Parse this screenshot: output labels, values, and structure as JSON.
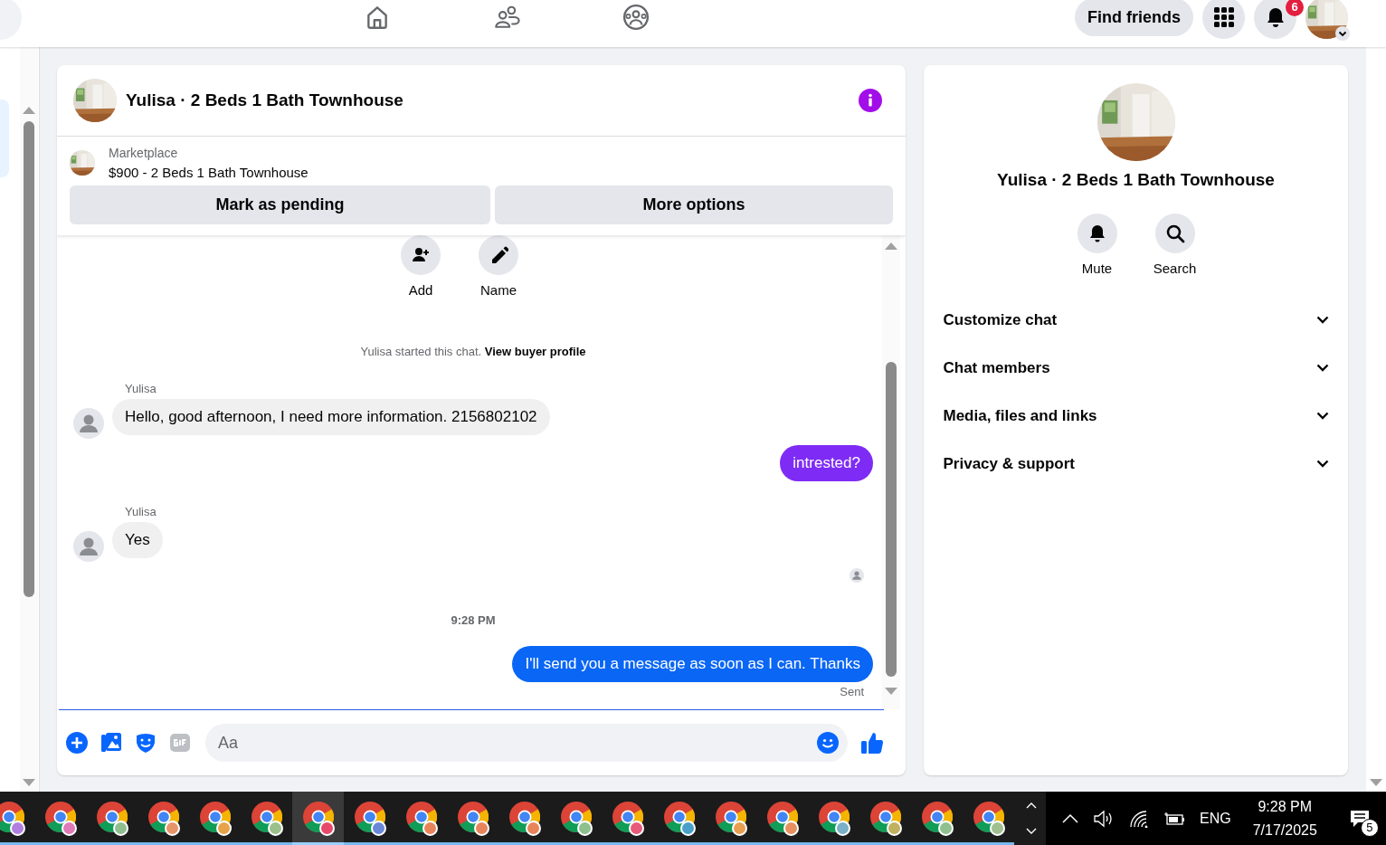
{
  "top_bar": {
    "nav": [
      {
        "kind": "home"
      },
      {
        "kind": "people"
      },
      {
        "kind": "groups"
      }
    ],
    "find_friends": "Find friends",
    "notification_badge": "6"
  },
  "chat": {
    "title": "Yulisa · 2 Beds 1 Bath Townhouse",
    "listing": {
      "label": "Marketplace",
      "title": "$900 - 2 Beds 1 Bath Townhouse"
    },
    "buttons": [
      "Mark as pending",
      "More options"
    ],
    "actions": [
      {
        "kind": "add",
        "label": "Add"
      },
      {
        "kind": "name",
        "label": "Name"
      }
    ],
    "messages": [
      {
        "kind": "system",
        "text": "Yulisa started this chat.",
        "link": "View buyer profile"
      },
      {
        "kind": "incoming",
        "sender": "Yulisa",
        "text": "Hello, good afternoon, I need more information. 2156802102"
      },
      {
        "kind": "outgoing",
        "text": "intrested?",
        "color": "#7e2cf5"
      },
      {
        "kind": "incoming",
        "sender": "Yulisa",
        "text": "Yes"
      },
      {
        "kind": "seen"
      },
      {
        "kind": "timestamp",
        "text": "9:28 PM"
      },
      {
        "kind": "outgoing",
        "text": "I'll send you a message as soon as I can. Thanks",
        "color": "#0a66f5",
        "status": "Sent"
      }
    ],
    "composer": {
      "placeholder": "Aa"
    }
  },
  "details": {
    "title": "Yulisa · 2 Beds 1 Bath Townhouse",
    "actions": [
      {
        "kind": "mute",
        "label": "Mute"
      },
      {
        "kind": "search",
        "label": "Search"
      }
    ],
    "sections": [
      {
        "label": "Customize chat",
        "expanded": false
      },
      {
        "label": "Chat members",
        "expanded": false
      },
      {
        "label": "Media, files and links",
        "expanded": false
      },
      {
        "label": "Privacy & support",
        "expanded": false
      }
    ]
  },
  "taskbar": {
    "apps": [
      {
        "color": "#b27fe0",
        "selected": false
      },
      {
        "color": "#e07ab8",
        "selected": false
      },
      {
        "color": "#8fbf8f",
        "selected": false
      },
      {
        "color": "#e8946a",
        "selected": false
      },
      {
        "color": "#e8a24a",
        "selected": false
      },
      {
        "color": "#9cc08a",
        "selected": false
      },
      {
        "color": "#e8486a",
        "selected": true
      },
      {
        "color": "#6a88d8",
        "selected": false
      },
      {
        "color": "#e8845a",
        "selected": false
      },
      {
        "color": "#e8845a",
        "selected": false
      },
      {
        "color": "#e8845a",
        "selected": false
      },
      {
        "color": "#8fbf8f",
        "selected": false
      },
      {
        "color": "#e85a7a",
        "selected": false
      },
      {
        "color": "#4aa0c8",
        "selected": false
      },
      {
        "color": "#e8a050",
        "selected": false
      },
      {
        "color": "#e89060",
        "selected": false
      },
      {
        "color": "#7ab0c8",
        "selected": false
      },
      {
        "color": "#c0b060",
        "selected": false
      },
      {
        "color": "#8fc090",
        "selected": false
      },
      {
        "color": "#a0c090",
        "selected": false
      }
    ],
    "language": "ENG",
    "time": "9:28 PM",
    "date": "7/17/2025",
    "notifications": "5"
  }
}
